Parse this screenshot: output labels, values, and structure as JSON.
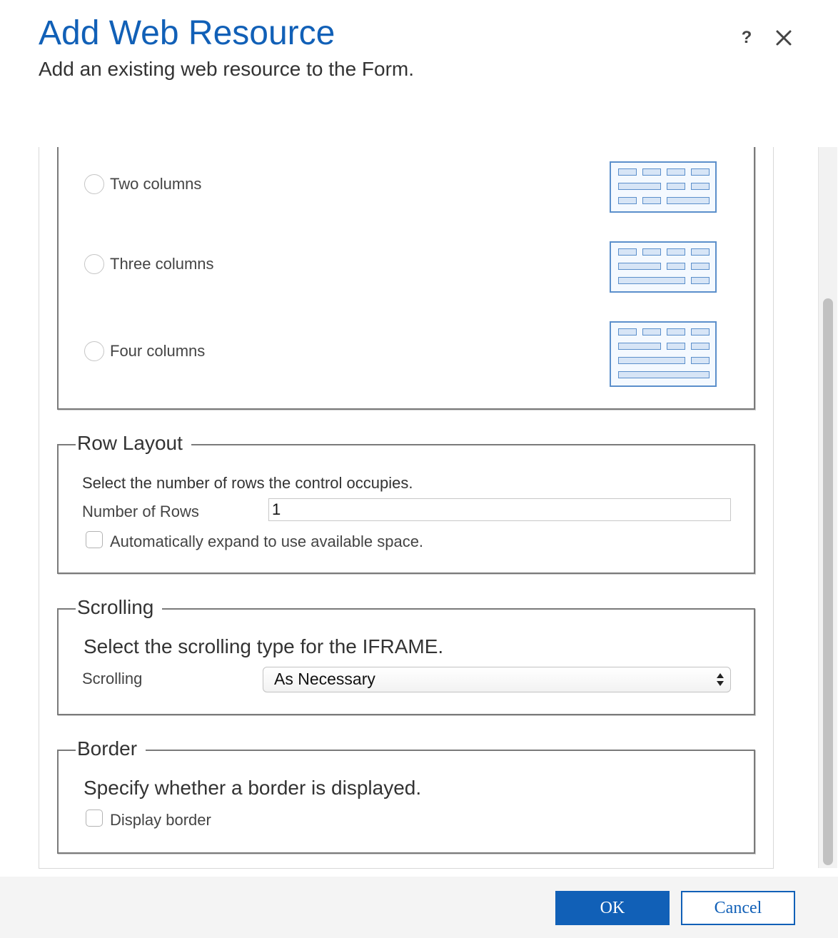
{
  "dialog": {
    "title": "Add Web Resource",
    "subtitle": "Add an existing web resource to the Form.",
    "help_label": "?",
    "accent_color": "#1160b7"
  },
  "column_layout": {
    "options": [
      {
        "label": "Two columns",
        "selected": false
      },
      {
        "label": "Three columns",
        "selected": false
      },
      {
        "label": "Four columns",
        "selected": false
      }
    ]
  },
  "row_layout": {
    "legend": "Row Layout",
    "description": "Select the number of rows the control occupies.",
    "rows_label": "Number of Rows",
    "rows_value": "1",
    "auto_expand_label": "Automatically expand to use available space.",
    "auto_expand_checked": false
  },
  "scrolling": {
    "legend": "Scrolling",
    "description": "Select the scrolling type for the IFRAME.",
    "label": "Scrolling",
    "selected_value": "As Necessary"
  },
  "border": {
    "legend": "Border",
    "description": "Specify whether a border is displayed.",
    "display_border_label": "Display border",
    "display_border_checked": false
  },
  "footer": {
    "ok_label": "OK",
    "cancel_label": "Cancel"
  }
}
